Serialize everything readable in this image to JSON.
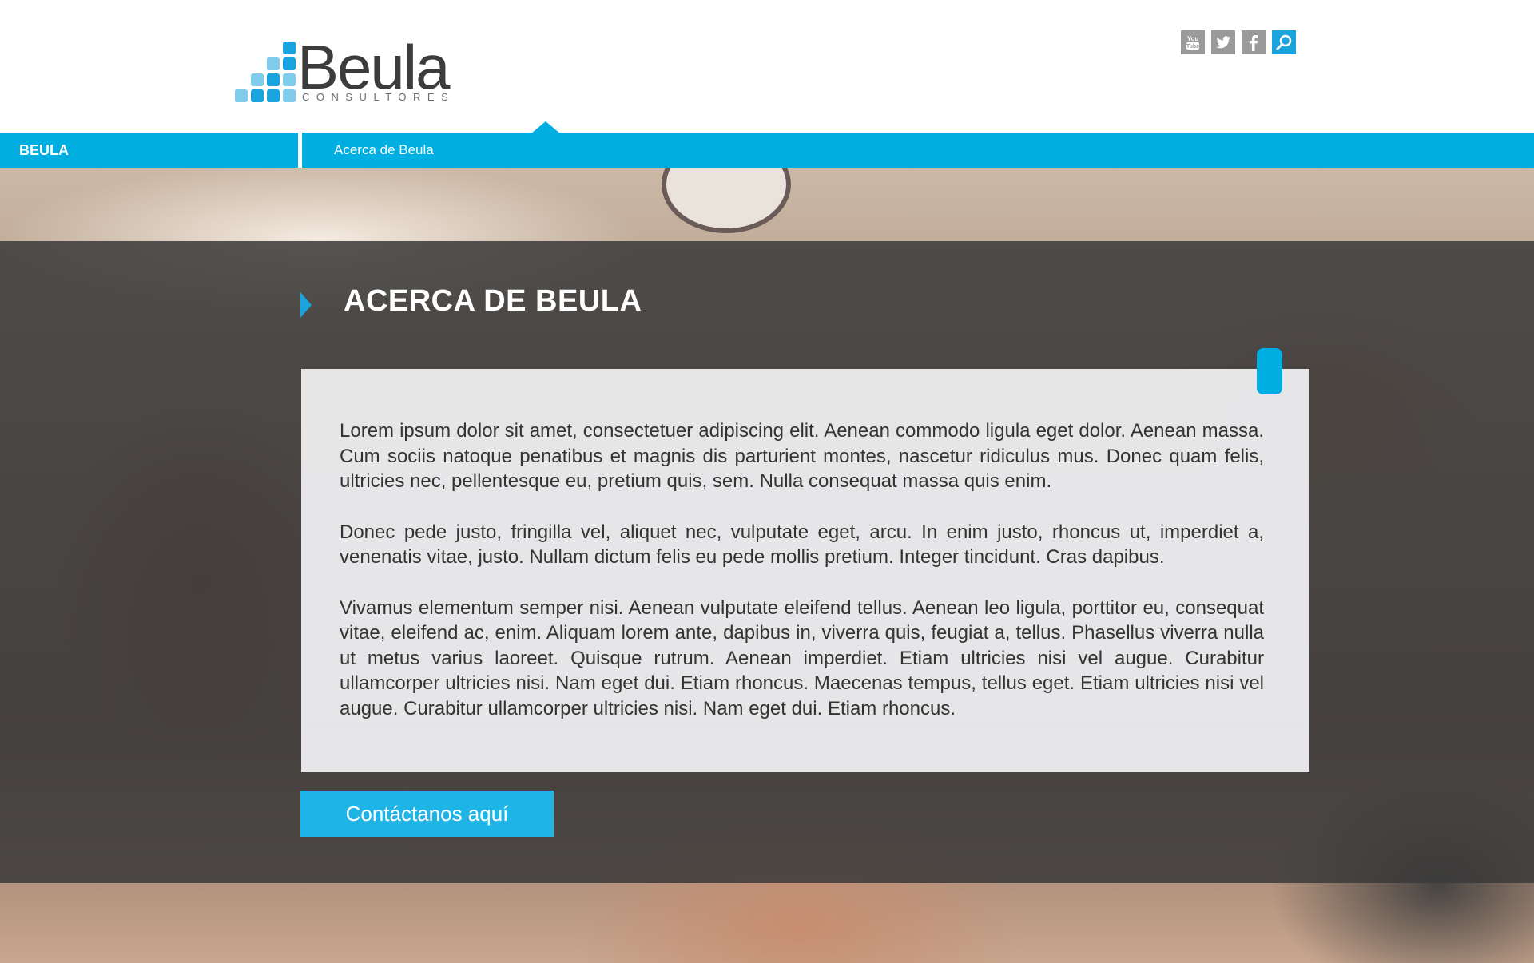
{
  "header": {
    "logo": {
      "word": "Beula",
      "sub": "CONSULTORES"
    },
    "social": [
      {
        "name": "youtube-icon"
      },
      {
        "name": "twitter-icon"
      },
      {
        "name": "facebook-icon"
      },
      {
        "name": "search-icon"
      }
    ]
  },
  "nav": {
    "brand": "BEULA",
    "item": "Acerca de Beula"
  },
  "section": {
    "title": "ACERCA DE BEULA",
    "paragraphs": [
      "Lorem ipsum dolor sit amet, consectetuer adipiscing elit. Aenean commodo ligula eget dolor. Aenean massa. Cum sociis natoque penatibus et magnis dis parturient montes, nascetur ridiculus mus. Donec quam felis, ultricies nec, pellentesque eu, pretium quis, sem. Nulla consequat massa quis enim.",
      "Donec pede justo, fringilla vel, aliquet nec, vulputate eget, arcu. In enim justo, rhoncus ut, imperdiet a, venenatis vitae, justo. Nullam dictum felis eu pede mollis pretium. Integer tincidunt. Cras dapibus.",
      "Vivamus elementum semper nisi. Aenean vulputate eleifend tellus. Aenean leo ligula, porttitor eu, consequat vitae, eleifend ac, enim. Aliquam lorem ante, dapibus in, viverra quis, feugiat a, tellus. Phasellus viverra nulla ut metus varius laoreet. Quisque rutrum. Aenean imperdiet. Etiam ultricies nisi vel augue. Curabitur ullamcorper ultricies nisi. Nam eget dui. Etiam rhoncus. Maecenas tempus, tellus eget. Etiam ultricies nisi vel augue. Curabitur ullamcorper ultricies nisi. Nam eget dui. Etiam rhoncus."
    ],
    "cta_label": "Contáctanos aquí"
  },
  "colors": {
    "accent": "#00aee2",
    "overlay": "#3a3a3a",
    "card": "#ececee",
    "logo_dark": "#3c3c3c"
  }
}
